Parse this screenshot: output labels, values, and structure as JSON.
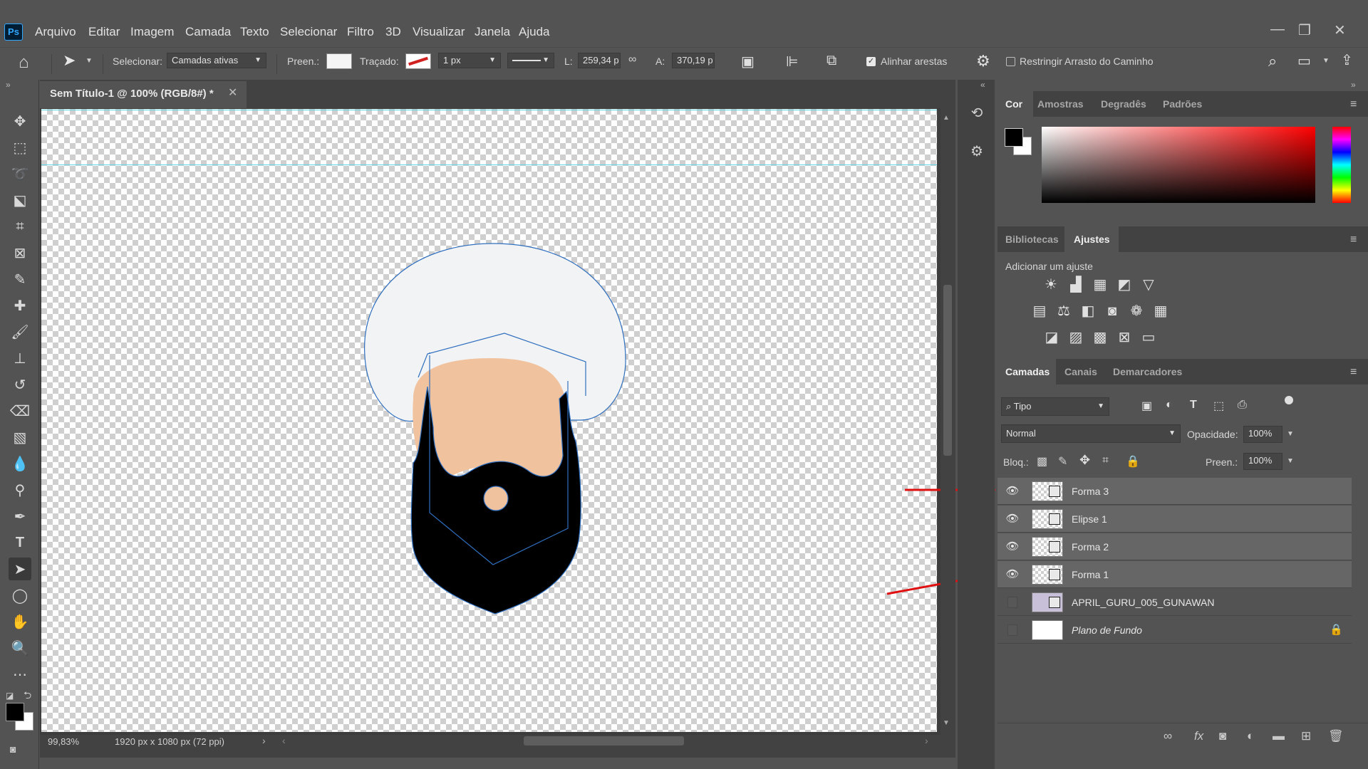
{
  "app": {
    "logo": "Ps"
  },
  "menu": [
    "Arquivo",
    "Editar",
    "Imagem",
    "Camada",
    "Texto",
    "Selecionar",
    "Filtro",
    "3D",
    "Visualizar",
    "Janela",
    "Ajuda"
  ],
  "window_controls": {
    "minimize": "—",
    "restore": "❐",
    "close": "✕"
  },
  "options": {
    "select_label": "Selecionar:",
    "select_value": "Camadas ativas",
    "fill_label": "Preen.:",
    "stroke_label": "Traçado:",
    "stroke_width": "1 px",
    "width_label": "L:",
    "width_value": "259,34 p",
    "height_label": "A:",
    "height_value": "370,19 p",
    "align_edges": "Alinhar arestas",
    "constrain_path": "Restringir Arrasto do Caminho"
  },
  "document": {
    "tab_title": "Sem Título-1 @ 100% (RGB/8#) *",
    "zoom": "99,83%",
    "size": "1920 px x 1080 px (72 ppi)"
  },
  "color_panel": {
    "tabs": [
      "Cor",
      "Amostras",
      "Degradês",
      "Padrões"
    ],
    "active_tab": "Cor",
    "foreground": "#000000",
    "background": "#ffffff"
  },
  "adjustments_panel": {
    "tabs": [
      "Bibliotecas",
      "Ajustes"
    ],
    "active_tab": "Ajustes",
    "hint": "Adicionar um ajuste"
  },
  "layers_panel": {
    "tabs": [
      "Camadas",
      "Canais",
      "Demarcadores"
    ],
    "active_tab": "Camadas",
    "filter": "Tipo",
    "blend_mode": "Normal",
    "opacity_label": "Opacidade:",
    "opacity_value": "100%",
    "lock_label": "Bloq.:",
    "fill_label": "Preen.:",
    "fill_value": "100%",
    "layers": [
      {
        "name": "Forma 3",
        "visible": true,
        "selected": true
      },
      {
        "name": "Elipse 1",
        "visible": true,
        "selected": true
      },
      {
        "name": "Forma 2",
        "visible": true,
        "selected": true
      },
      {
        "name": "Forma 1",
        "visible": true,
        "selected": true
      },
      {
        "name": "APRIL_GURU_005_GUNAWAN",
        "visible": false,
        "selected": false
      },
      {
        "name": "Plano de Fundo",
        "visible": false,
        "selected": false,
        "locked": true
      }
    ]
  },
  "colors": {
    "turban": "#f2f3f4",
    "face": "#f1c29e",
    "beard": "#000000",
    "path_outline": "#2f6fbf",
    "guide": "#5fd7e6",
    "annotation_arrow": "#e01010"
  }
}
